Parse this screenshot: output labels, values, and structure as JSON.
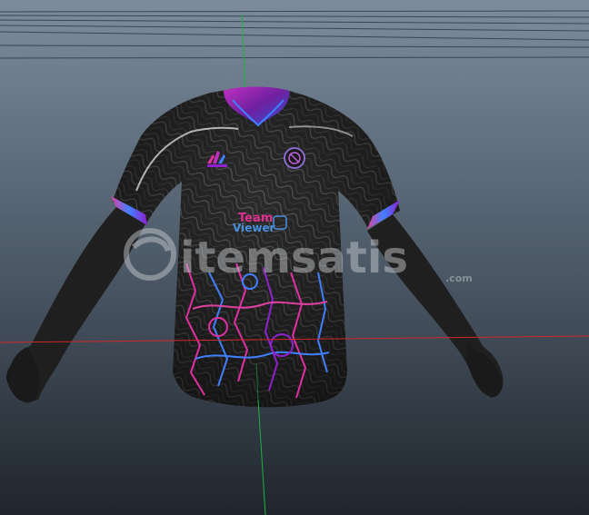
{
  "viewport": {
    "background_top": "#7d8c9c",
    "background_bottom": "#1f252c",
    "grid_color": "#2c3a4a",
    "axis_x_color": "#d02828",
    "axis_y_color": "#20b040"
  },
  "model": {
    "name": "jersey-mesh",
    "base_color": "#2a2a2a",
    "trim_colors": [
      "#e040a0",
      "#4080ff",
      "#9020d0"
    ],
    "pattern_accent": "#e030a0"
  },
  "jersey": {
    "sponsor_line1": "Team",
    "sponsor_line2": "Viewer"
  },
  "watermark": {
    "text": "itemsatis",
    "suffix": ".com"
  },
  "icons": {
    "brand_logo": "adidas-logo-icon",
    "crest": "club-crest-icon",
    "watermark_logo": "itemsatis-logo-icon"
  }
}
